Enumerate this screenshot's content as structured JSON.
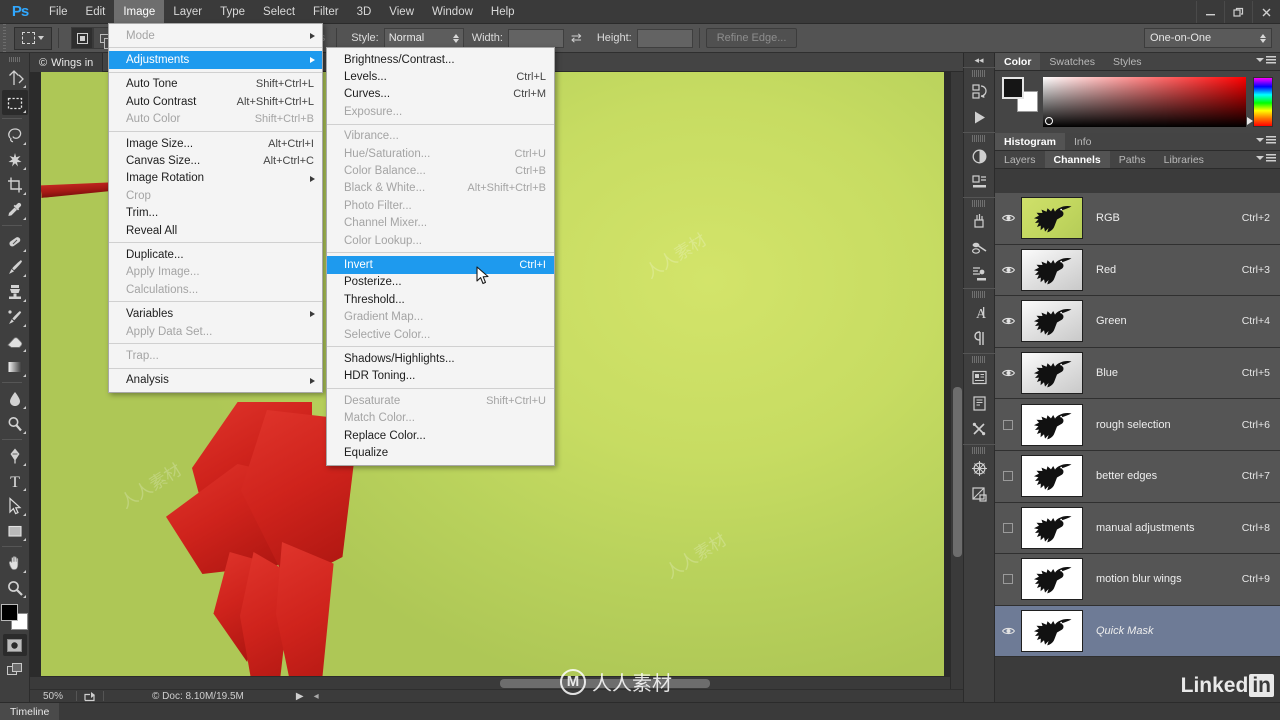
{
  "app": {
    "logo": "Ps",
    "title": "Adobe Photoshop"
  },
  "menubar": {
    "items": [
      {
        "label": "File"
      },
      {
        "label": "Edit"
      },
      {
        "label": "Image",
        "active": true
      },
      {
        "label": "Layer"
      },
      {
        "label": "Type"
      },
      {
        "label": "Select"
      },
      {
        "label": "Filter"
      },
      {
        "label": "3D"
      },
      {
        "label": "View"
      },
      {
        "label": "Window"
      },
      {
        "label": "Help"
      }
    ],
    "window_controls": [
      "minimize-icon",
      "restore-icon",
      "close-icon"
    ]
  },
  "options_bar": {
    "tool_preset_icon": "rectangular-marquee-icon",
    "style_label": "Style:",
    "style_value": "Normal",
    "width_label": "Width:",
    "width_value": "",
    "height_label": "Height:",
    "height_value": "",
    "swap_icon": "swap-dimensions-icon",
    "refine_edge_label": "Refine Edge...",
    "workspace_value": "One-on-One"
  },
  "toolbar": {
    "tools": [
      {
        "name": "move-tool"
      },
      {
        "name": "rectangular-marquee-tool",
        "selected": true
      },
      {
        "name": "lasso-tool"
      },
      {
        "name": "magic-wand-tool"
      },
      {
        "name": "crop-tool"
      },
      {
        "name": "eyedropper-tool"
      },
      {
        "name": "healing-brush-tool"
      },
      {
        "name": "brush-tool"
      },
      {
        "name": "clone-stamp-tool"
      },
      {
        "name": "history-brush-tool"
      },
      {
        "name": "eraser-tool"
      },
      {
        "name": "gradient-tool"
      },
      {
        "name": "blur-tool"
      },
      {
        "name": "dodge-tool"
      },
      {
        "name": "pen-tool"
      },
      {
        "name": "type-tool"
      },
      {
        "name": "path-selection-tool"
      },
      {
        "name": "shape-tool"
      },
      {
        "name": "hand-tool"
      },
      {
        "name": "zoom-tool"
      }
    ],
    "foreground_color": "#151515",
    "background_color": "#ffffff",
    "quick_mask_icon": "quick-mask-icon",
    "screen_mode_icon": "screen-mode-icon"
  },
  "document": {
    "tab_label": "Wings in",
    "tab_icon": "copyright-icon"
  },
  "status_bar": {
    "zoom": "50%",
    "share_icon": "share-icon",
    "doc_info": "Doc: 8.10M/19.5M",
    "copyright_icon": "copyright-icon"
  },
  "timeline": {
    "tab_label": "Timeline"
  },
  "image_menu": {
    "items": [
      {
        "label": "Mode",
        "shortcut": "",
        "disabled": true,
        "submenu": true
      },
      {
        "sep": true
      },
      {
        "label": "Adjustments",
        "shortcut": "",
        "highlighted": true,
        "submenu": true
      },
      {
        "sep": true
      },
      {
        "label": "Auto Tone",
        "shortcut": "Shift+Ctrl+L"
      },
      {
        "label": "Auto Contrast",
        "shortcut": "Alt+Shift+Ctrl+L"
      },
      {
        "label": "Auto Color",
        "shortcut": "Shift+Ctrl+B",
        "disabled": true
      },
      {
        "sep": true
      },
      {
        "label": "Image Size...",
        "shortcut": "Alt+Ctrl+I"
      },
      {
        "label": "Canvas Size...",
        "shortcut": "Alt+Ctrl+C"
      },
      {
        "label": "Image Rotation",
        "shortcut": "",
        "submenu": true
      },
      {
        "label": "Crop",
        "shortcut": "",
        "disabled": true
      },
      {
        "label": "Trim...",
        "shortcut": ""
      },
      {
        "label": "Reveal All",
        "shortcut": ""
      },
      {
        "sep": true
      },
      {
        "label": "Duplicate...",
        "shortcut": ""
      },
      {
        "label": "Apply Image...",
        "shortcut": "",
        "disabled": true
      },
      {
        "label": "Calculations...",
        "shortcut": "",
        "disabled": true
      },
      {
        "sep": true
      },
      {
        "label": "Variables",
        "shortcut": "",
        "submenu": true
      },
      {
        "label": "Apply Data Set...",
        "shortcut": "",
        "disabled": true
      },
      {
        "sep": true
      },
      {
        "label": "Trap...",
        "shortcut": "",
        "disabled": true
      },
      {
        "sep": true
      },
      {
        "label": "Analysis",
        "shortcut": "",
        "submenu": true
      }
    ]
  },
  "adjustments_menu": {
    "items": [
      {
        "label": "Brightness/Contrast...",
        "shortcut": ""
      },
      {
        "label": "Levels...",
        "shortcut": "Ctrl+L"
      },
      {
        "label": "Curves...",
        "shortcut": "Ctrl+M"
      },
      {
        "label": "Exposure...",
        "shortcut": "",
        "disabled": true
      },
      {
        "sep": true
      },
      {
        "label": "Vibrance...",
        "shortcut": "",
        "disabled": true
      },
      {
        "label": "Hue/Saturation...",
        "shortcut": "Ctrl+U",
        "disabled": true
      },
      {
        "label": "Color Balance...",
        "shortcut": "Ctrl+B",
        "disabled": true
      },
      {
        "label": "Black & White...",
        "shortcut": "Alt+Shift+Ctrl+B",
        "disabled": true
      },
      {
        "label": "Photo Filter...",
        "shortcut": "",
        "disabled": true
      },
      {
        "label": "Channel Mixer...",
        "shortcut": "",
        "disabled": true
      },
      {
        "label": "Color Lookup...",
        "shortcut": "",
        "disabled": true
      },
      {
        "sep": true
      },
      {
        "label": "Invert",
        "shortcut": "Ctrl+I",
        "highlighted": true
      },
      {
        "label": "Posterize...",
        "shortcut": ""
      },
      {
        "label": "Threshold...",
        "shortcut": ""
      },
      {
        "label": "Gradient Map...",
        "shortcut": "",
        "disabled": true
      },
      {
        "label": "Selective Color...",
        "shortcut": "",
        "disabled": true
      },
      {
        "sep": true
      },
      {
        "label": "Shadows/Highlights...",
        "shortcut": ""
      },
      {
        "label": "HDR Toning...",
        "shortcut": ""
      },
      {
        "sep": true
      },
      {
        "label": "Desaturate",
        "shortcut": "Shift+Ctrl+U",
        "disabled": true
      },
      {
        "label": "Match Color...",
        "shortcut": "",
        "disabled": true
      },
      {
        "label": "Replace Color...",
        "shortcut": ""
      },
      {
        "label": "Equalize",
        "shortcut": ""
      }
    ]
  },
  "color_panel": {
    "tabs": [
      {
        "label": "Color",
        "active": true
      },
      {
        "label": "Swatches",
        "active": false
      },
      {
        "label": "Styles",
        "active": false
      }
    ],
    "foreground": "#151515",
    "background": "#ffffff"
  },
  "histogram_panel": {
    "tabs": [
      {
        "label": "Histogram",
        "active": true
      },
      {
        "label": "Info",
        "active": false
      }
    ]
  },
  "layers_panel": {
    "tabs": [
      {
        "label": "Layers",
        "active": false
      },
      {
        "label": "Channels",
        "active": true
      },
      {
        "label": "Paths",
        "active": false
      },
      {
        "label": "Libraries",
        "active": false
      }
    ]
  },
  "channels": [
    {
      "name": "RGB",
      "shortcut": "Ctrl+2",
      "visible": true,
      "thumb": "rgb",
      "selected": false,
      "italic": false
    },
    {
      "name": "Red",
      "shortcut": "Ctrl+3",
      "visible": true,
      "thumb": "gray",
      "selected": false,
      "italic": false
    },
    {
      "name": "Green",
      "shortcut": "Ctrl+4",
      "visible": true,
      "thumb": "gray",
      "selected": false,
      "italic": false
    },
    {
      "name": "Blue",
      "shortcut": "Ctrl+5",
      "visible": true,
      "thumb": "gray",
      "selected": false,
      "italic": false
    },
    {
      "name": "rough selection",
      "shortcut": "Ctrl+6",
      "visible": false,
      "thumb": "mask",
      "selected": false,
      "italic": false
    },
    {
      "name": "better edges",
      "shortcut": "Ctrl+7",
      "visible": false,
      "thumb": "mask",
      "selected": false,
      "italic": false
    },
    {
      "name": "manual adjustments",
      "shortcut": "Ctrl+8",
      "visible": false,
      "thumb": "mask",
      "selected": false,
      "italic": false
    },
    {
      "name": "motion blur wings",
      "shortcut": "Ctrl+9",
      "visible": false,
      "thumb": "mask",
      "selected": false,
      "italic": false
    },
    {
      "name": "Quick Mask",
      "shortcut": "",
      "visible": true,
      "thumb": "mask",
      "selected": true,
      "italic": true
    }
  ],
  "right_rail": {
    "collapse_icon": "collapse-panels-icon",
    "groups": [
      [
        "history-icon",
        "actions-icon"
      ],
      [
        "adjustments-icon",
        "properties-icon"
      ],
      [
        "brush-icon",
        "brush-presets-icon",
        "tool-presets-icon"
      ],
      [
        "character-icon",
        "paragraph-icon"
      ],
      [
        "layer-comps-icon",
        "notes-icon",
        "measurement-icon"
      ],
      [
        "3d-icon",
        "clone-source-icon"
      ]
    ]
  },
  "watermarks": {
    "center": "人人素材",
    "corner": "Linked",
    "corner_box": "in"
  },
  "colors": {
    "accent_blue": "#1e9aee",
    "panel_bg": "#3b3b3b",
    "menu_bg": "#f4f4f4",
    "canvas_green": "#c7dc62",
    "bird_red": "#cf231c",
    "selected_row": "#6e7b96"
  }
}
